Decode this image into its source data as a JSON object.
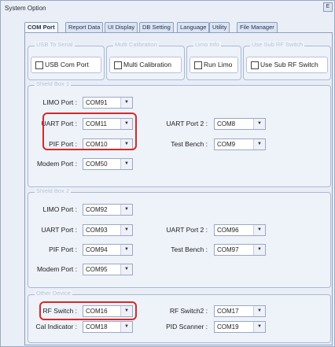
{
  "window": {
    "title": "System Option",
    "close_glyph": "Ε"
  },
  "tabs": [
    {
      "label": "COM Port",
      "active": true
    },
    {
      "label": "Report Data",
      "active": false
    },
    {
      "label": "UI Display",
      "active": false
    },
    {
      "label": "DB Setting",
      "active": false
    },
    {
      "label": "Language",
      "active": false
    },
    {
      "label": "Utility",
      "active": false
    },
    {
      "label": "File Manager",
      "active": false
    }
  ],
  "checks": [
    {
      "group": "USB To Serial",
      "label": "USB Com Port",
      "checked": false
    },
    {
      "group": "Multi Calibration",
      "label": "Multi Calibration",
      "checked": false
    },
    {
      "group": "Limo Info",
      "label": "Run Limo",
      "checked": false
    },
    {
      "group": "Use Sub RF Switch",
      "label": "Use Sub RF Switch",
      "checked": false
    }
  ],
  "box1": {
    "title": "Shield Box 1",
    "limo_label": "LIMO Port :",
    "limo": "COM91",
    "uart_label": "UART Port :",
    "uart": "COM11",
    "uart2_label": "UART Port 2 :",
    "uart2": "COM8",
    "pif_label": "PIF Port :",
    "pif": "COM10",
    "tb_label": "Test Bench :",
    "tb": "COM9",
    "modem_label": "Modem Port :",
    "modem": "COM50"
  },
  "box2": {
    "title": "Shield Box 2",
    "limo_label": "LIMO Port :",
    "limo": "COM92",
    "uart_label": "UART Port :",
    "uart": "COM93",
    "uart2_label": "UART Port 2 :",
    "uart2": "COM96",
    "pif_label": "PIF Port :",
    "pif": "COM94",
    "tb_label": "Test Bench :",
    "tb": "COM97",
    "modem_label": "Modem Port :",
    "modem": "COM95"
  },
  "other": {
    "title": "Other Device",
    "rf_label": "RF Switch :",
    "rf": "COM16",
    "rf2_label": "RF Switch2 :",
    "rf2": "COM17",
    "cal_label": "Cal Indicator :",
    "cal": "COM18",
    "pid_label": "PID Scanner :",
    "pid": "COM19"
  },
  "icons": {
    "combo_arrow": "▼",
    "checkbox": "checkbox-icon"
  },
  "colors": {
    "highlight": "#d42a2a",
    "tab_border": "#8ea0bf",
    "group_title": "#b7c5de"
  }
}
